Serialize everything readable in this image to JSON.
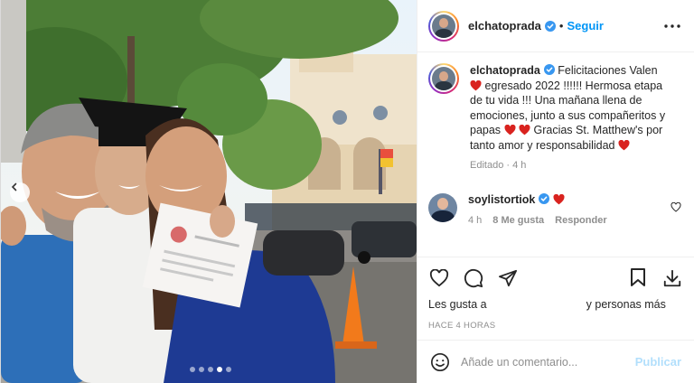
{
  "post": {
    "username": "elchatoprada",
    "follow_label": "Seguir",
    "separator": "•",
    "caption": {
      "username": "elchatoprada",
      "line1": " Felicitaciones Valen",
      "line2": " egresado 2022 !!!!!! Hermosa etapa de tu vida !!! Una mañana llena de emociones, junto a sus compañeritos y papas ",
      "line3": " Gracias St. Matthew's por tanto amor y responsabilidad ",
      "time": "Editado · 4 h"
    },
    "comment": {
      "username": "soylistortiok",
      "time": "4 h",
      "likes": "8 Me gusta",
      "reply": "Responder"
    },
    "likes_prefix": "Les gusta a",
    "likes_suffix": "y personas más",
    "ago": "HACE 4 HORAS",
    "add_comment_placeholder": "Añade un comentario...",
    "publish_label": "Publicar"
  },
  "carousel": {
    "dots": 5,
    "active": 3
  },
  "colors": {
    "accent": "#0095f6",
    "heart": "#ed4956",
    "verified": "#3897f0",
    "muted": "#8e8e8e"
  },
  "icons": [
    "chevron-left-icon",
    "verified-icon",
    "more-icon",
    "heart-icon",
    "comment-icon",
    "share-icon",
    "save-icon",
    "download-icon",
    "emoji-icon"
  ]
}
